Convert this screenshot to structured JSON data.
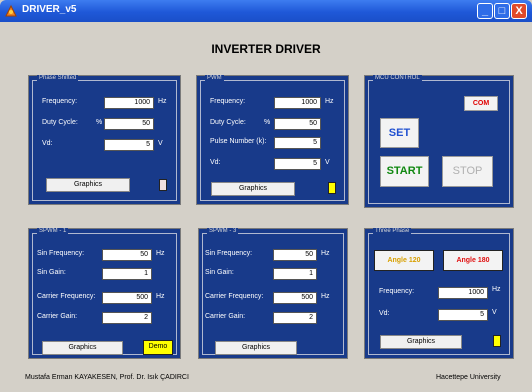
{
  "window": {
    "title": "DRIVER_v5",
    "min": "_",
    "max": "□",
    "close": "X"
  },
  "app_title": "INVERTER DRIVER",
  "phase_shifted": {
    "title": "Phase Shifted",
    "frequency": {
      "label": "Frequency:",
      "value": "1000",
      "unit": "Hz"
    },
    "duty": {
      "label": "Duty Cycle:",
      "prefix": "%",
      "value": "50"
    },
    "vd": {
      "label": "Vd:",
      "value": "5",
      "unit": "V"
    },
    "graphics": "Graphics"
  },
  "pwm": {
    "title": "PWM",
    "frequency": {
      "label": "Frequency:",
      "value": "1000",
      "unit": "Hz"
    },
    "duty": {
      "label": "Duty Cycle:",
      "prefix": "%",
      "value": "50"
    },
    "pulse": {
      "label": "Pulse Number (k):",
      "value": "5"
    },
    "vd": {
      "label": "Vd:",
      "value": "5",
      "unit": "V"
    },
    "graphics": "Graphics"
  },
  "mcu": {
    "title": "MCU CONTROL",
    "com": "COM",
    "set": "SET",
    "start": "START",
    "stop": "STOP",
    "colors": {
      "com": "#e00000",
      "set": "#2050d0",
      "start": "#108810",
      "stop": "#b0b0b0"
    }
  },
  "spwm1": {
    "title": "SPWM - 1",
    "sin_freq": {
      "label": "Sin Frequency:",
      "value": "50",
      "unit": "Hz"
    },
    "sin_gain": {
      "label": "Sin Gain:",
      "value": "1"
    },
    "carrier_freq": {
      "label": "Carrier Frequency:",
      "value": "500",
      "unit": "Hz"
    },
    "carrier_gain": {
      "label": "Carrier Gain:",
      "value": "2"
    },
    "graphics": "Graphics",
    "demo": "Demo"
  },
  "spwm3": {
    "title": "SPWM - 3",
    "sin_freq": {
      "label": "Sin Frequency:",
      "value": "50",
      "unit": "Hz"
    },
    "sin_gain": {
      "label": "Sin Gain:",
      "value": "1"
    },
    "carrier_freq": {
      "label": "Carrier Frequency:",
      "value": "500",
      "unit": "Hz"
    },
    "carrier_gain": {
      "label": "Carrier Gain:",
      "value": "2"
    },
    "graphics": "Graphics"
  },
  "three_phase": {
    "title": "Three Phase",
    "angle120": "Angle 120",
    "angle180": "Angle 180",
    "frequency": {
      "label": "Frequency:",
      "value": "1000",
      "unit": "Hz"
    },
    "vd": {
      "label": "Vd:",
      "value": "5",
      "unit": "V"
    },
    "graphics": "Graphics"
  },
  "footer": {
    "authors": "Mustafa Erman KAYAKESEN,  Prof. Dr. Isık ÇADIRCI",
    "university": "Hacettepe University"
  }
}
